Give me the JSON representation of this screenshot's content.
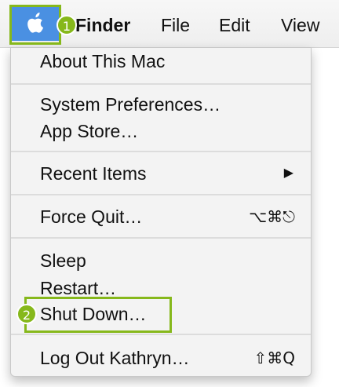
{
  "menubar": {
    "apple_icon": "apple-logo-icon",
    "app_name": "Finder",
    "items": [
      "File",
      "Edit",
      "View"
    ]
  },
  "annotations": {
    "badge1": "1",
    "badge2": "2",
    "highlight_color": "#86b81b"
  },
  "apple_menu": {
    "highlight_color": "#4a90e2",
    "about": "About This Mac",
    "system_preferences": "System Preferences…",
    "app_store": "App Store…",
    "recent_items": "Recent Items",
    "recent_items_arrow": "▶",
    "force_quit": "Force Quit…",
    "force_quit_shortcut": "⌥⌘⎋",
    "sleep": "Sleep",
    "restart": "Restart…",
    "shut_down": "Shut Down…",
    "log_out": "Log Out Kathryn…",
    "log_out_shortcut": "⇧⌘Q"
  }
}
